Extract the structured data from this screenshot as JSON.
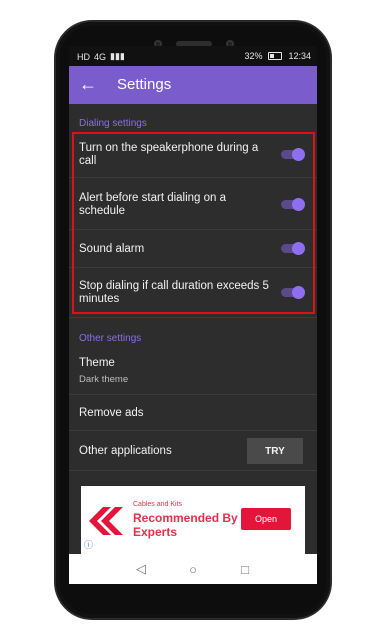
{
  "status_bar": {
    "left_indicators": [
      "HD",
      "4G"
    ],
    "battery": "32%",
    "time": "12:34"
  },
  "app_bar": {
    "back_icon": "arrow-left-icon",
    "title": "Settings"
  },
  "dialing_settings": {
    "header": "Dialing settings",
    "items": [
      {
        "label": "Turn on the speakerphone during a call",
        "enabled": true
      },
      {
        "label": "Alert before start dialing on a schedule",
        "enabled": true
      },
      {
        "label": "Sound alarm",
        "enabled": true
      },
      {
        "label": "Stop dialing if call duration exceeds 5 minutes",
        "enabled": true
      }
    ]
  },
  "other_settings": {
    "header": "Other settings",
    "theme": {
      "label": "Theme",
      "value": "Dark theme"
    },
    "remove_ads": "Remove ads",
    "other_applications": {
      "label": "Other applications",
      "button": "TRY"
    }
  },
  "ad": {
    "subtitle": "Cables and Kits",
    "headline": "Recommended By Experts",
    "button": "Open",
    "info_icon": "info-icon"
  },
  "colors": {
    "accent": "#7b5ccc",
    "background": "#2d2d2d",
    "highlight": "#e0101a"
  }
}
